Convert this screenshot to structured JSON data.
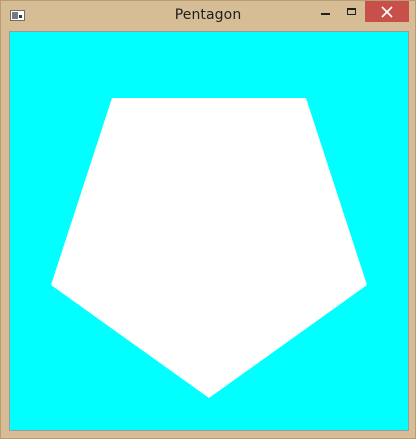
{
  "window": {
    "title": "Pentagon",
    "controls": {
      "minimize_icon": "minimize-icon",
      "maximize_icon": "maximize-icon",
      "close_icon": "close-icon"
    }
  },
  "canvas": {
    "background_color": "#00ffff",
    "shape": {
      "type": "pentagon",
      "fill_color": "#ffffff"
    }
  }
}
